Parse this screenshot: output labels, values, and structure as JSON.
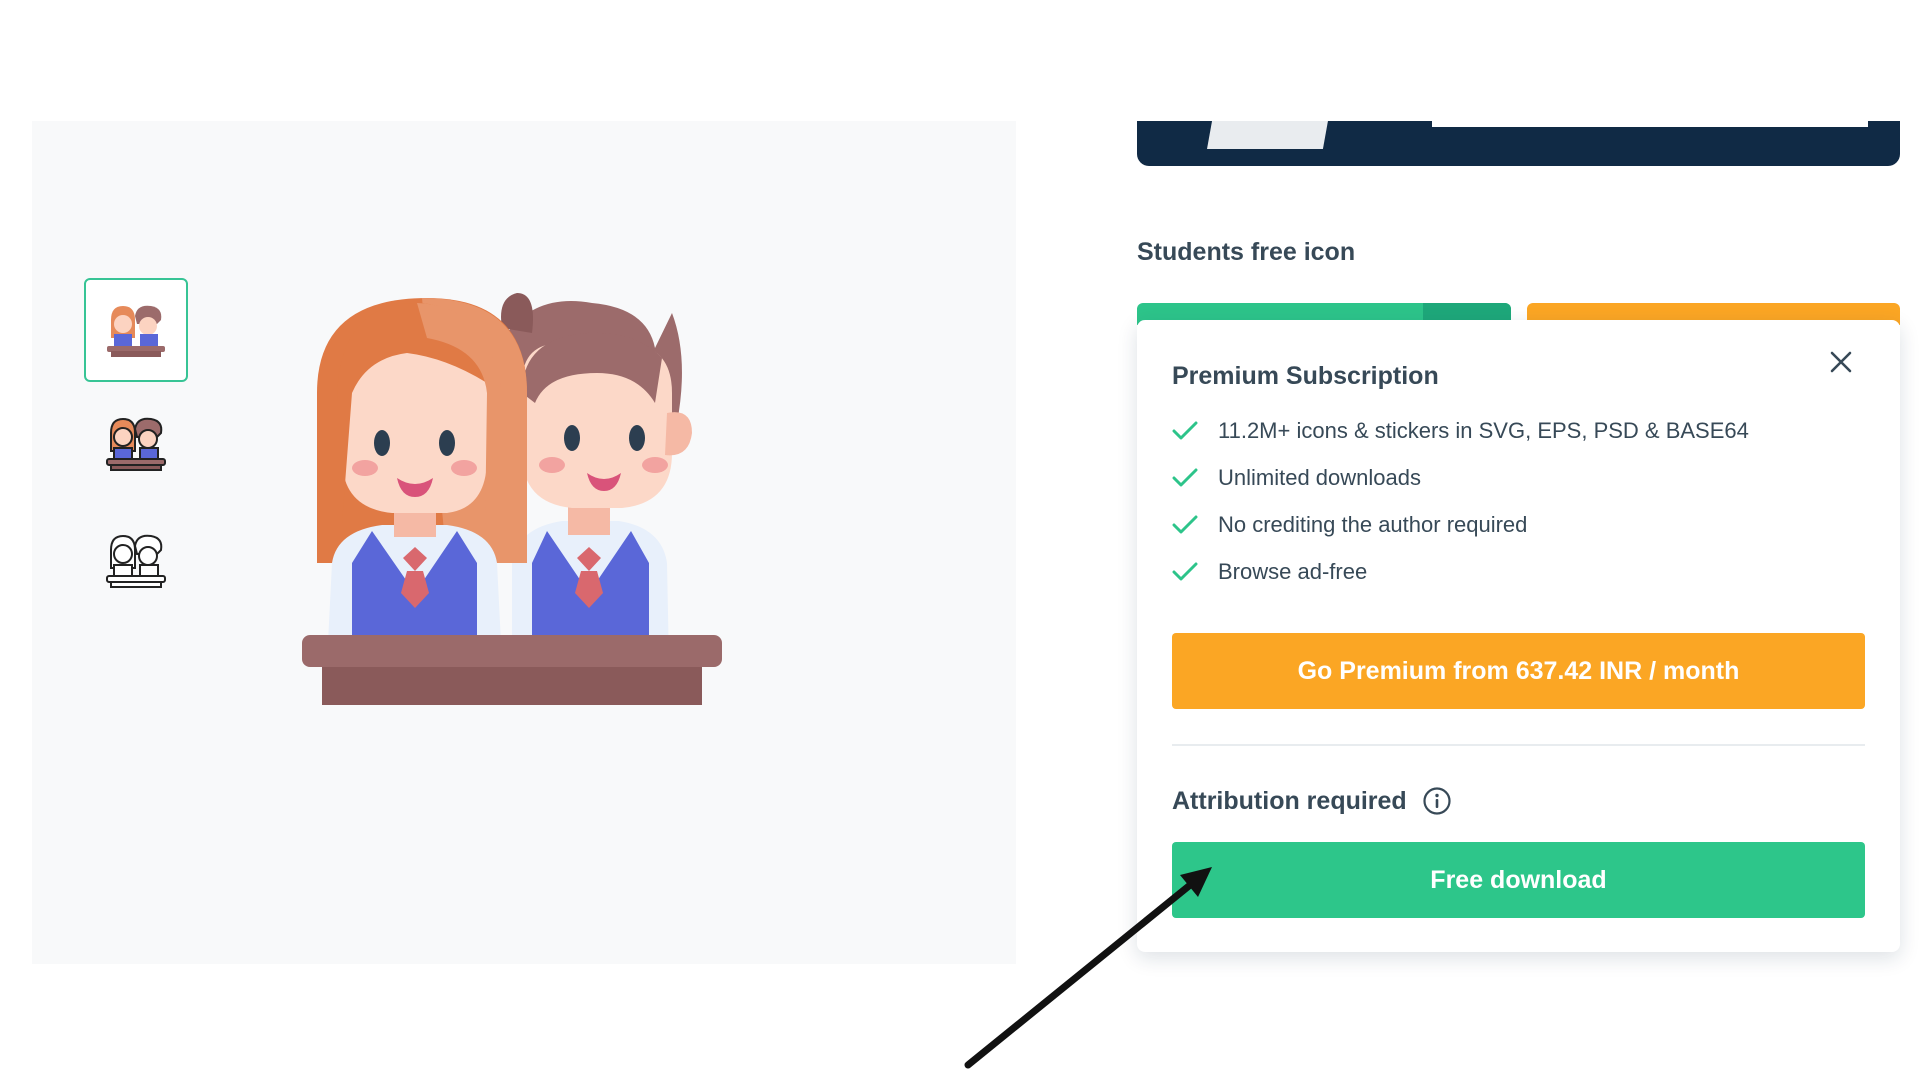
{
  "page_title": "Students free icon",
  "thumbnails": [
    {
      "name": "thumb-flat-color",
      "active": true
    },
    {
      "name": "thumb-lineal-color",
      "active": false
    },
    {
      "name": "thumb-lineal",
      "active": false
    }
  ],
  "premium": {
    "title": "Premium Subscription",
    "features": [
      "11.2M+ icons & stickers in SVG, EPS, PSD & BASE64",
      "Unlimited downloads",
      "No crediting the author required",
      "Browse ad-free"
    ],
    "cta_label": "Go Premium from 637.42 INR / month"
  },
  "attribution": {
    "label": "Attribution required",
    "download_label": "Free download"
  },
  "colors": {
    "accent_green": "#2dc68a",
    "accent_orange": "#fba624",
    "banner_navy": "#102a45",
    "check_green": "#2dc48a"
  },
  "icons": [
    "close-icon",
    "check-icon",
    "info-icon",
    "arrow-annotation-icon"
  ]
}
